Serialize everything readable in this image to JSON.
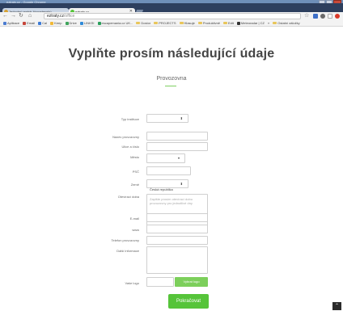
{
  "browser": {
    "window_title": "eztraty.cz - Google Chrome",
    "tabs": [
      {
        "label": "Jednotný registr živnostenský..."
      },
      {
        "label": "eztraty.cz"
      }
    ],
    "url_host": "eztraty.cz",
    "url_path": "/office",
    "bookmarks": [
      {
        "label": "Aplikace",
        "icon": "apps-icon",
        "color": "#4a7bd0"
      },
      {
        "label": "Email",
        "icon": "mail-icon",
        "color": "#c6453a"
      },
      {
        "label": "Cal",
        "icon": "calendar-icon",
        "color": "#3d7ad6"
      },
      {
        "label": "Keep",
        "icon": "keep-icon",
        "color": "#f1b836"
      },
      {
        "label": "Drive",
        "icon": "drive-icon",
        "color": "#3fa45b"
      },
      {
        "label": "LINKS!",
        "icon": "links-icon",
        "color": "#2f8ad8"
      },
      {
        "label": "escapemania.cz UK...",
        "icon": "escape-icon",
        "color": "#2aa05b"
      },
      {
        "label": "Dostor",
        "icon": "folder-icon",
        "color": "#e8c65a"
      },
      {
        "label": "PROJECTS",
        "icon": "folder-icon",
        "color": "#e8c65a"
      },
      {
        "label": "Hlasuje",
        "icon": "folder-icon",
        "color": "#e8c65a"
      },
      {
        "label": "Produktivně",
        "icon": "folder-icon",
        "color": "#e8c65a"
      },
      {
        "label": "Edit",
        "icon": "folder-icon",
        "color": "#e8c65a"
      },
      {
        "label": "Meteoradar | CZ",
        "icon": "radar-icon",
        "color": "#333333"
      },
      {
        "label": "»",
        "icon": "more-icon",
        "color": "#555555"
      },
      {
        "label": "Ostatní záložky",
        "icon": "folder-icon",
        "color": "#e8c65a"
      }
    ]
  },
  "page": {
    "title": "Vyplňte prosím následující údaje",
    "section": "Provozovna",
    "accent_color": "#56c43a"
  },
  "form": {
    "type_label": "Typ instituce",
    "type_value": "",
    "name_label": "Název provozovny",
    "street_label": "Ulice a číslo",
    "city_label": "Město",
    "city_value": "",
    "zip_label": "PSČ",
    "country_label": "Země",
    "country_value": "Česká republika",
    "hours_label": "Otevírací doba",
    "hours_placeholder": "Zapište prosím otevírací dobu provozovny pro jednotlivé dny",
    "email_label": "E-mail",
    "www_label": "www",
    "phone_label": "Telefon provozovny",
    "info_label": "Další informace",
    "logo_label": "Vaše logo",
    "upload_button": "Vybrat logo",
    "submit_button": "Pokračovat"
  }
}
